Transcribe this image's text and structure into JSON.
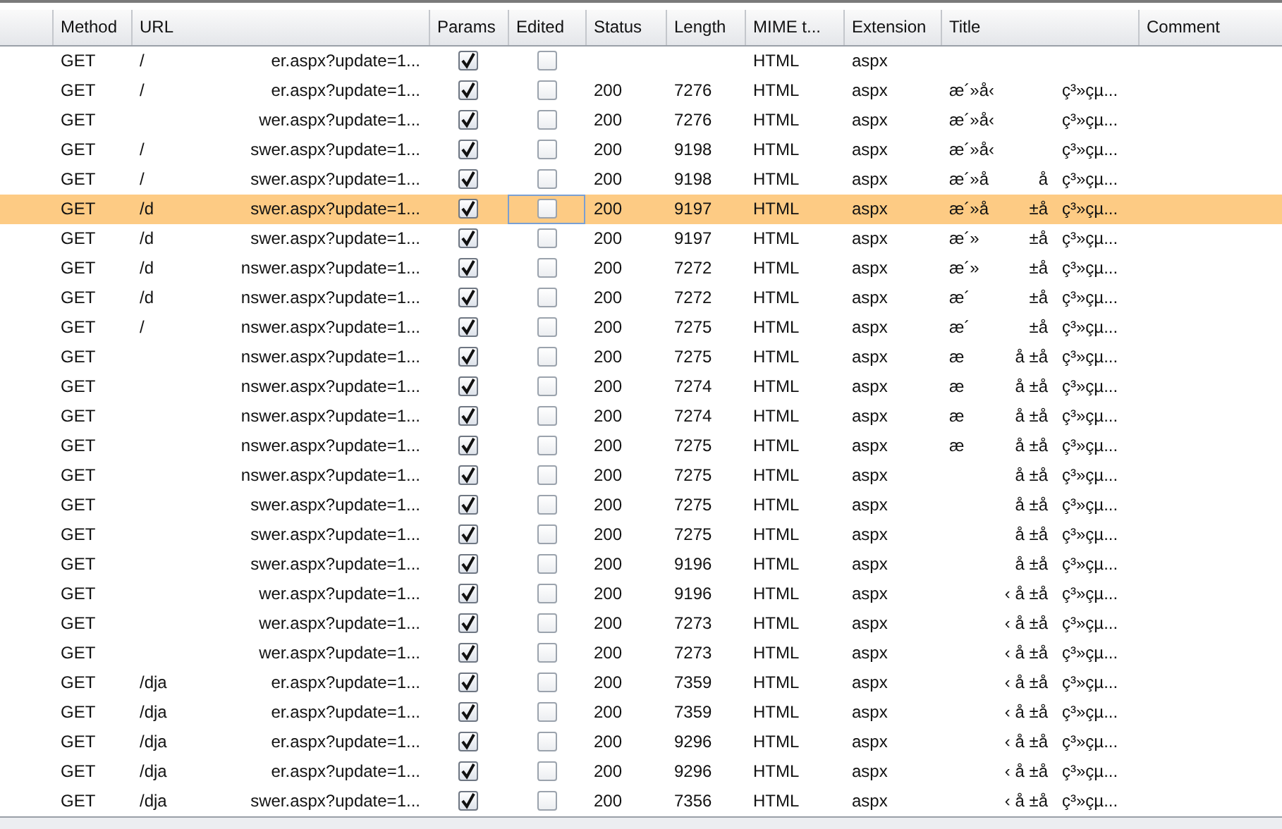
{
  "columns": [
    "Method",
    "URL",
    "Params",
    "Edited",
    "Status",
    "Length",
    "MIME t...",
    "Extension",
    "Title",
    "Comment"
  ],
  "rows": [
    {
      "method": "GET",
      "url_start": "/",
      "url_end": "er.aspx?update=1...",
      "params": true,
      "edited": false,
      "mime": "HTML",
      "extension": "aspx",
      "selected": false
    },
    {
      "method": "GET",
      "url_start": "/",
      "url_end": "er.aspx?update=1...",
      "params": true,
      "edited": false,
      "status": "200",
      "length": "7276",
      "mime": "HTML",
      "extension": "aspx",
      "title_start": "æ´»å‹",
      "title_end": "ç³»çµ...",
      "selected": false
    },
    {
      "method": "GET",
      "url_end": "wer.aspx?update=1...",
      "params": true,
      "edited": false,
      "status": "200",
      "length": "7276",
      "mime": "HTML",
      "extension": "aspx",
      "title_start": "æ´»å‹",
      "title_end": "ç³»çµ...",
      "selected": false
    },
    {
      "method": "GET",
      "url_start": "/",
      "url_end": "swer.aspx?update=1...",
      "params": true,
      "edited": false,
      "status": "200",
      "length": "9198",
      "mime": "HTML",
      "extension": "aspx",
      "title_start": "æ´»å‹",
      "title_end": "ç³»çµ...",
      "selected": false
    },
    {
      "method": "GET",
      "url_start": "/",
      "url_end": "swer.aspx?update=1...",
      "params": true,
      "edited": false,
      "status": "200",
      "length": "9198",
      "mime": "HTML",
      "extension": "aspx",
      "title_start": "æ´»å",
      "title_middle": "å",
      "title_end": "ç³»çµ...",
      "selected": false
    },
    {
      "method": "GET",
      "url_start": "/d",
      "url_end": "swer.aspx?update=1...",
      "params": true,
      "edited": false,
      "status": "200",
      "length": "9197",
      "mime": "HTML",
      "extension": "aspx",
      "title_start": "æ´»å",
      "title_middle": "±å",
      "title_end": "ç³»çµ...",
      "selected": true
    },
    {
      "method": "GET",
      "url_start": "/d",
      "url_end": "swer.aspx?update=1...",
      "params": true,
      "edited": false,
      "status": "200",
      "length": "9197",
      "mime": "HTML",
      "extension": "aspx",
      "title_start": "æ´»",
      "title_middle": "±å",
      "title_end": "ç³»çµ...",
      "selected": false
    },
    {
      "method": "GET",
      "url_start": "/d",
      "url_end": "nswer.aspx?update=1...",
      "params": true,
      "edited": false,
      "status": "200",
      "length": "7272",
      "mime": "HTML",
      "extension": "aspx",
      "title_start": "æ´»",
      "title_middle": "±å",
      "title_end": "ç³»çµ...",
      "selected": false
    },
    {
      "method": "GET",
      "url_start": "/d",
      "url_end": "nswer.aspx?update=1...",
      "params": true,
      "edited": false,
      "status": "200",
      "length": "7272",
      "mime": "HTML",
      "extension": "aspx",
      "title_start": "æ´",
      "title_middle": "±å",
      "title_end": "ç³»çµ...",
      "selected": false
    },
    {
      "method": "GET",
      "url_start": "/",
      "url_end": "nswer.aspx?update=1...",
      "params": true,
      "edited": false,
      "status": "200",
      "length": "7275",
      "mime": "HTML",
      "extension": "aspx",
      "title_start": "æ´",
      "title_middle": "±å",
      "title_end": "ç³»çµ...",
      "selected": false
    },
    {
      "method": "GET",
      "url_end": "nswer.aspx?update=1...",
      "params": true,
      "edited": false,
      "status": "200",
      "length": "7275",
      "mime": "HTML",
      "extension": "aspx",
      "title_start": "æ",
      "title_middle": "å ±å",
      "title_end": "ç³»çµ...",
      "selected": false
    },
    {
      "method": "GET",
      "url_end": "nswer.aspx?update=1...",
      "params": true,
      "edited": false,
      "status": "200",
      "length": "7274",
      "mime": "HTML",
      "extension": "aspx",
      "title_start": "æ",
      "title_middle": "å ±å",
      "title_end": "ç³»çµ...",
      "selected": false
    },
    {
      "method": "GET",
      "url_end": "nswer.aspx?update=1...",
      "params": true,
      "edited": false,
      "status": "200",
      "length": "7274",
      "mime": "HTML",
      "extension": "aspx",
      "title_start": "æ",
      "title_middle": "å ±å",
      "title_end": "ç³»çµ...",
      "selected": false
    },
    {
      "method": "GET",
      "url_end": "nswer.aspx?update=1...",
      "params": true,
      "edited": false,
      "status": "200",
      "length": "7275",
      "mime": "HTML",
      "extension": "aspx",
      "title_start": "æ",
      "title_middle": "å ±å",
      "title_end": "ç³»çµ...",
      "selected": false
    },
    {
      "method": "GET",
      "url_end": "nswer.aspx?update=1...",
      "params": true,
      "edited": false,
      "status": "200",
      "length": "7275",
      "mime": "HTML",
      "extension": "aspx",
      "title_middle": "å ±å",
      "title_end": "ç³»çµ...",
      "selected": false
    },
    {
      "method": "GET",
      "url_end": "swer.aspx?update=1...",
      "params": true,
      "edited": false,
      "status": "200",
      "length": "7275",
      "mime": "HTML",
      "extension": "aspx",
      "title_middle": "å ±å",
      "title_end": "ç³»çµ...",
      "selected": false
    },
    {
      "method": "GET",
      "url_end": "swer.aspx?update=1...",
      "params": true,
      "edited": false,
      "status": "200",
      "length": "7275",
      "mime": "HTML",
      "extension": "aspx",
      "title_middle": "å ±å",
      "title_end": "ç³»çµ...",
      "selected": false
    },
    {
      "method": "GET",
      "url_end": "swer.aspx?update=1...",
      "params": true,
      "edited": false,
      "status": "200",
      "length": "9196",
      "mime": "HTML",
      "extension": "aspx",
      "title_middle": "å ±å",
      "title_end": "ç³»çµ...",
      "selected": false
    },
    {
      "method": "GET",
      "url_end": "wer.aspx?update=1...",
      "params": true,
      "edited": false,
      "status": "200",
      "length": "9196",
      "mime": "HTML",
      "extension": "aspx",
      "title_middle": "‹ å ±å",
      "title_end": "ç³»çµ...",
      "selected": false
    },
    {
      "method": "GET",
      "url_end": "wer.aspx?update=1...",
      "params": true,
      "edited": false,
      "status": "200",
      "length": "7273",
      "mime": "HTML",
      "extension": "aspx",
      "title_middle": "‹ å ±å",
      "title_end": "ç³»çµ...",
      "selected": false
    },
    {
      "method": "GET",
      "url_end": "wer.aspx?update=1...",
      "params": true,
      "edited": false,
      "status": "200",
      "length": "7273",
      "mime": "HTML",
      "extension": "aspx",
      "title_middle": "‹ å ±å",
      "title_end": "ç³»çµ...",
      "selected": false
    },
    {
      "method": "GET",
      "url_start": "/dja",
      "url_end": "er.aspx?update=1...",
      "params": true,
      "edited": false,
      "status": "200",
      "length": "7359",
      "mime": "HTML",
      "extension": "aspx",
      "title_middle": "‹ å ±å",
      "title_end": "ç³»çµ...",
      "selected": false
    },
    {
      "method": "GET",
      "url_start": "/dja",
      "url_end": "er.aspx?update=1...",
      "params": true,
      "edited": false,
      "status": "200",
      "length": "7359",
      "mime": "HTML",
      "extension": "aspx",
      "title_middle": "‹ å ±å",
      "title_end": "ç³»çµ...",
      "selected": false
    },
    {
      "method": "GET",
      "url_start": "/dja",
      "url_end": "er.aspx?update=1...",
      "params": true,
      "edited": false,
      "status": "200",
      "length": "9296",
      "mime": "HTML",
      "extension": "aspx",
      "title_middle": "‹ å ±å",
      "title_end": "ç³»çµ...",
      "selected": false
    },
    {
      "method": "GET",
      "url_start": "/dja",
      "url_end": "er.aspx?update=1...",
      "params": true,
      "edited": false,
      "status": "200",
      "length": "9296",
      "mime": "HTML",
      "extension": "aspx",
      "title_middle": "‹ å ±å",
      "title_end": "ç³»çµ...",
      "selected": false
    },
    {
      "method": "GET",
      "url_start": "/dja",
      "url_end": "swer.aspx?update=1...",
      "params": true,
      "edited": false,
      "status": "200",
      "length": "7356",
      "mime": "HTML",
      "extension": "aspx",
      "title_middle": "‹ å ±å",
      "title_end": "ç³»çµ...",
      "selected": false
    }
  ]
}
